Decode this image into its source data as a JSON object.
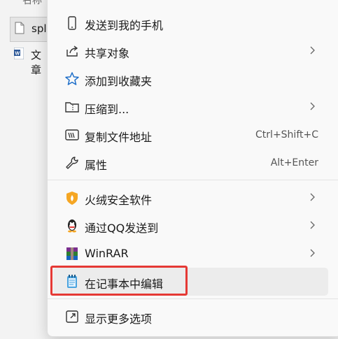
{
  "background": {
    "header": "名称",
    "file_selected": "spli",
    "file_doc": "文章"
  },
  "menu": {
    "items": [
      {
        "label": "发送到我的手机",
        "icon": "phone-icon"
      },
      {
        "label": "共享对象",
        "icon": "share-icon",
        "submenu": true
      },
      {
        "label": "添加到收藏夹",
        "icon": "star-icon"
      },
      {
        "label": "压缩到...",
        "icon": "zip-folder-icon",
        "submenu": true
      },
      {
        "label": "复制文件地址",
        "icon": "copy-path-icon",
        "shortcut": "Ctrl+Shift+C"
      },
      {
        "label": "属性",
        "icon": "wrench-icon",
        "shortcut": "Alt+Enter"
      },
      {
        "label": "火绒安全软件",
        "icon": "huorong-shield-icon",
        "submenu": true
      },
      {
        "label": "通过QQ发送到",
        "icon": "qq-penguin-icon",
        "submenu": true
      },
      {
        "label": "WinRAR",
        "icon": "winrar-icon",
        "submenu": true
      },
      {
        "label": "在记事本中编辑",
        "icon": "notepad-icon",
        "highlighted": true
      },
      {
        "label": "显示更多选项",
        "icon": "more-options-icon"
      }
    ]
  },
  "colors": {
    "highlight_border": "#e53935",
    "accent": "#0067c0"
  }
}
